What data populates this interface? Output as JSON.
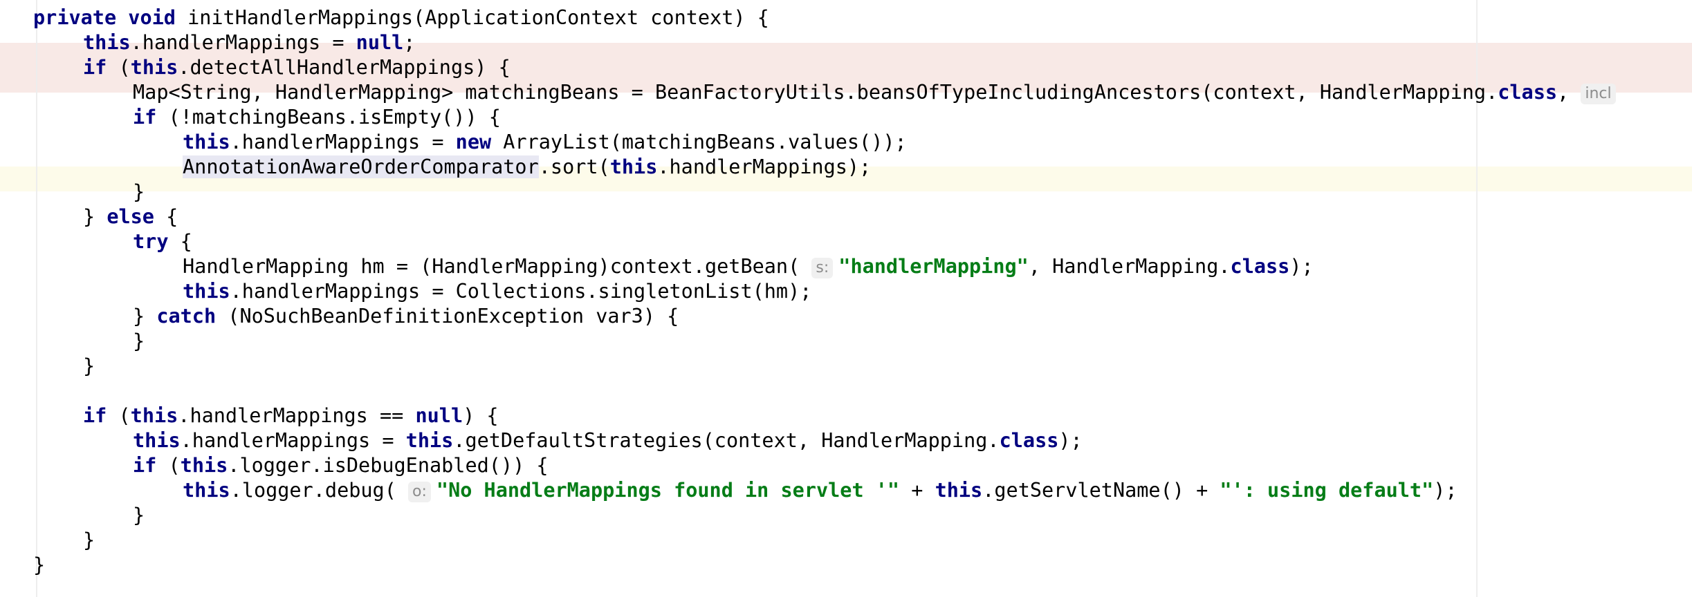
{
  "editor": {
    "lines": [
      {
        "id": "method-signature",
        "indent": 0,
        "tokens": [
          {
            "t": "private",
            "c": "kw"
          },
          {
            "t": " "
          },
          {
            "t": "void",
            "c": "kw"
          },
          {
            "t": " initHandlerMappings(ApplicationContext context) {"
          }
        ]
      },
      {
        "id": "assign-null",
        "indent": 1,
        "tokens": [
          {
            "t": "this",
            "c": "kw"
          },
          {
            "t": ".handlerMappings = "
          },
          {
            "t": "null",
            "c": "kw"
          },
          {
            "t": ";"
          }
        ]
      },
      {
        "id": "if-detect-all",
        "indent": 1,
        "tokens": [
          {
            "t": "if",
            "c": "kw"
          },
          {
            "t": " ("
          },
          {
            "t": "this",
            "c": "kw"
          },
          {
            "t": ".detectAllHandlerMappings) {"
          }
        ]
      },
      {
        "id": "matching-beans",
        "indent": 2,
        "tokens": [
          {
            "t": "Map<String, HandlerMapping> matchingBeans = BeanFactoryUtils.beansOfTypeIncludingAncestors(context, HandlerMapping."
          },
          {
            "t": "class",
            "c": "kw"
          },
          {
            "t": ", "
          },
          {
            "t": "incl",
            "c": "hint"
          }
        ]
      },
      {
        "id": "if-not-empty",
        "indent": 2,
        "tokens": [
          {
            "t": "if",
            "c": "kw"
          },
          {
            "t": " (!matchingBeans.isEmpty()) {"
          }
        ]
      },
      {
        "id": "new-arraylist",
        "indent": 3,
        "tokens": [
          {
            "t": "this",
            "c": "kw"
          },
          {
            "t": ".handlerMappings = "
          },
          {
            "t": "new",
            "c": "kw"
          },
          {
            "t": " ArrayList(matchingBeans.values());"
          }
        ]
      },
      {
        "id": "sort-call",
        "indent": 3,
        "tokens": [
          {
            "t": "AnnotationAwareOrderComparator",
            "c": "ident-hl"
          },
          {
            "t": ".sort("
          },
          {
            "t": "this",
            "c": "kw"
          },
          {
            "t": ".handlerMappings);"
          }
        ]
      },
      {
        "id": "close-if-not-empty",
        "indent": 2,
        "tokens": [
          {
            "t": "}"
          }
        ]
      },
      {
        "id": "else-branch",
        "indent": 1,
        "tokens": [
          {
            "t": "} "
          },
          {
            "t": "else",
            "c": "kw"
          },
          {
            "t": " {"
          }
        ]
      },
      {
        "id": "try-open",
        "indent": 2,
        "tokens": [
          {
            "t": "try",
            "c": "kw"
          },
          {
            "t": " {"
          }
        ]
      },
      {
        "id": "get-bean",
        "indent": 3,
        "tokens": [
          {
            "t": "HandlerMapping hm = (HandlerMapping)context.getBean( "
          },
          {
            "t": "s:",
            "c": "hint"
          },
          {
            "t": "\"handlerMapping\"",
            "c": "str"
          },
          {
            "t": ", HandlerMapping."
          },
          {
            "t": "class",
            "c": "kw"
          },
          {
            "t": ");"
          }
        ]
      },
      {
        "id": "singleton-list",
        "indent": 3,
        "tokens": [
          {
            "t": "this",
            "c": "kw"
          },
          {
            "t": ".handlerMappings = Collections.singletonList(hm);"
          }
        ]
      },
      {
        "id": "catch-clause",
        "indent": 2,
        "tokens": [
          {
            "t": "} "
          },
          {
            "t": "catch",
            "c": "kw"
          },
          {
            "t": " (NoSuchBeanDefinitionException var3) {"
          }
        ]
      },
      {
        "id": "close-catch",
        "indent": 2,
        "tokens": [
          {
            "t": "}"
          }
        ]
      },
      {
        "id": "close-else",
        "indent": 1,
        "tokens": [
          {
            "t": "}"
          }
        ]
      },
      {
        "id": "blank-line",
        "indent": 0,
        "tokens": []
      },
      {
        "id": "if-null-check",
        "indent": 1,
        "tokens": [
          {
            "t": "if",
            "c": "kw"
          },
          {
            "t": " ("
          },
          {
            "t": "this",
            "c": "kw"
          },
          {
            "t": ".handlerMappings == "
          },
          {
            "t": "null",
            "c": "kw"
          },
          {
            "t": ") {"
          }
        ]
      },
      {
        "id": "default-strategies",
        "indent": 2,
        "tokens": [
          {
            "t": "this",
            "c": "kw"
          },
          {
            "t": ".handlerMappings = "
          },
          {
            "t": "this",
            "c": "kw"
          },
          {
            "t": ".getDefaultStrategies(context, HandlerMapping."
          },
          {
            "t": "class",
            "c": "kw"
          },
          {
            "t": ");"
          }
        ]
      },
      {
        "id": "if-debug-enabled",
        "indent": 2,
        "tokens": [
          {
            "t": "if",
            "c": "kw"
          },
          {
            "t": " ("
          },
          {
            "t": "this",
            "c": "kw"
          },
          {
            "t": ".logger.isDebugEnabled()) {"
          }
        ]
      },
      {
        "id": "logger-debug",
        "indent": 3,
        "tokens": [
          {
            "t": "this",
            "c": "kw"
          },
          {
            "t": ".logger.debug( "
          },
          {
            "t": "o:",
            "c": "hint"
          },
          {
            "t": "\"No HandlerMappings found in servlet '\"",
            "c": "str"
          },
          {
            "t": " + "
          },
          {
            "t": "this",
            "c": "kw"
          },
          {
            "t": ".getServletName() + "
          },
          {
            "t": "\"': using default\"",
            "c": "str"
          },
          {
            "t": ");"
          }
        ]
      },
      {
        "id": "close-if-debug",
        "indent": 2,
        "tokens": [
          {
            "t": "}"
          }
        ]
      },
      {
        "id": "close-if-null",
        "indent": 1,
        "tokens": [
          {
            "t": "}"
          }
        ]
      },
      {
        "id": "close-method",
        "indent": 0,
        "tokens": [
          {
            "t": "}"
          }
        ]
      }
    ]
  }
}
